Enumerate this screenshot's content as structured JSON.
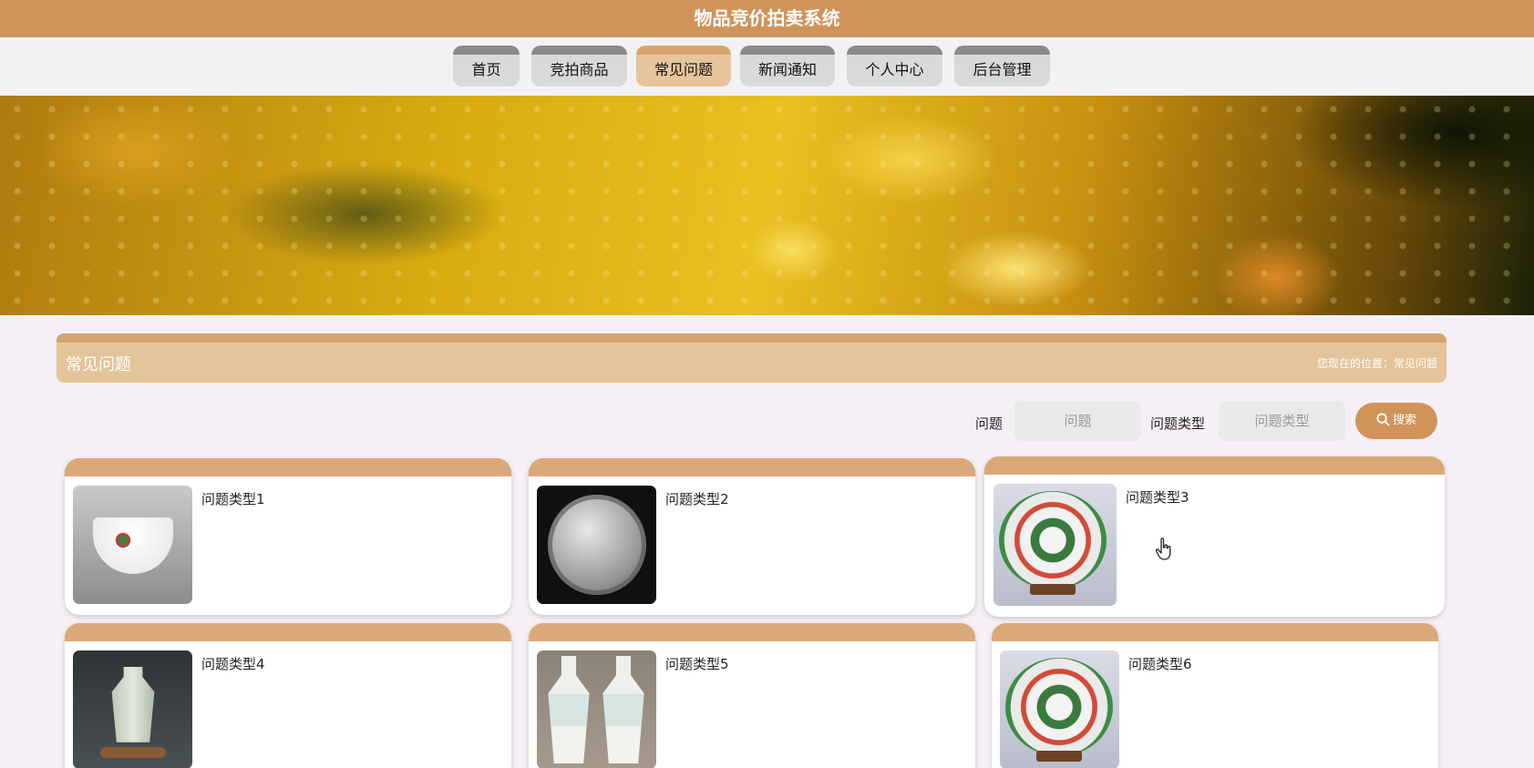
{
  "header": {
    "title": "物品竞价拍卖系统"
  },
  "nav": {
    "items": [
      {
        "label": "首页"
      },
      {
        "label": "竞拍商品"
      },
      {
        "label": "常见问题"
      },
      {
        "label": "新闻通知"
      },
      {
        "label": "个人中心"
      },
      {
        "label": "后台管理"
      }
    ],
    "active": "常见问题"
  },
  "section": {
    "title": "常见问题",
    "breadcrumb": "您现在的位置：常见问题"
  },
  "search": {
    "question_label": "问题",
    "question_placeholder": "问题",
    "type_label": "问题类型",
    "type_placeholder": "问题类型",
    "button_label": "搜索"
  },
  "cards": [
    {
      "label": "问题类型1",
      "image": "porcelain-bowl"
    },
    {
      "label": "问题类型2",
      "image": "silver-coin"
    },
    {
      "label": "问题类型3",
      "image": "dragon-plate"
    },
    {
      "label": "问题类型4",
      "image": "celadon-vase"
    },
    {
      "label": "问题类型5",
      "image": "pair-of-vases"
    },
    {
      "label": "问题类型6",
      "image": "dragon-plate"
    }
  ],
  "colors": {
    "brand": "#d0935a",
    "nav_active": "#e6c59c",
    "section_header": "#e4c49a",
    "card_top": "#dba878"
  }
}
